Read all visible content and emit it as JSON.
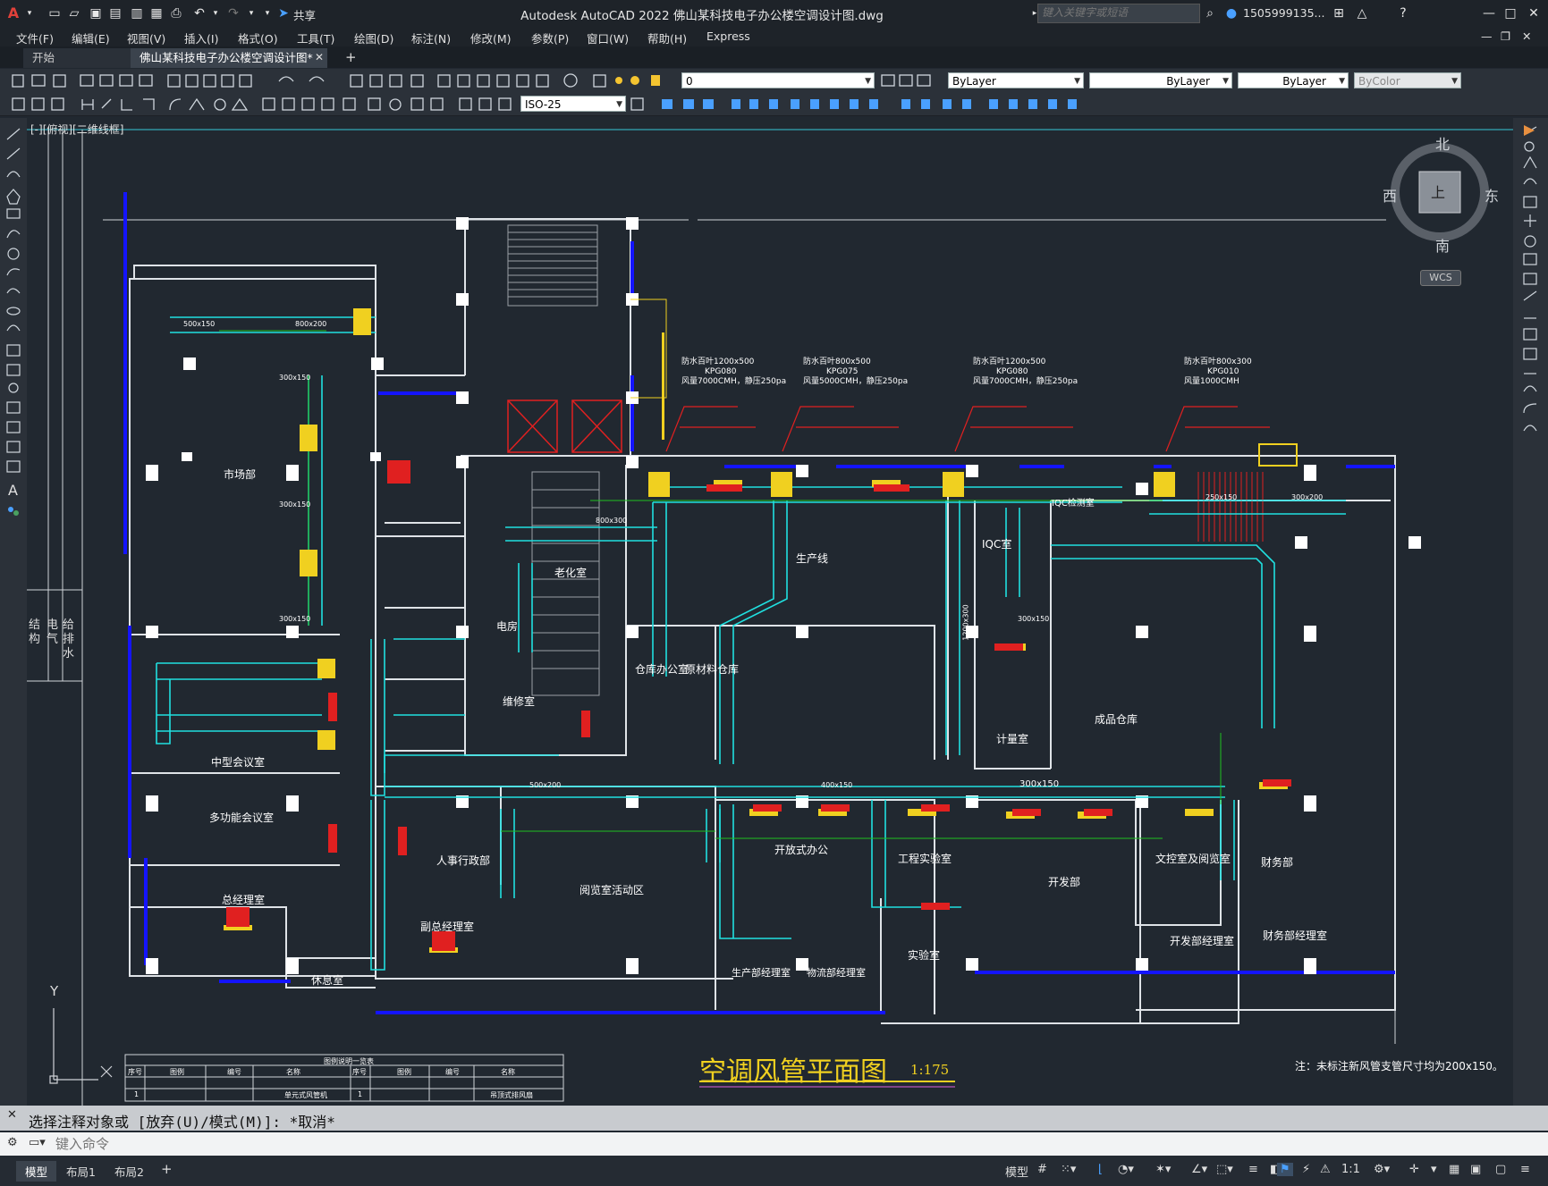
{
  "app": {
    "title": "Autodesk AutoCAD 2022    佛山某科技电子办公楼空调设计图.dwg",
    "share_label": "共享",
    "search_placeholder": "键入关键字或短语",
    "user": "1505999135...",
    "logo": "A"
  },
  "menu": [
    "文件(F)",
    "编辑(E)",
    "视图(V)",
    "插入(I)",
    "格式(O)",
    "工具(T)",
    "绘图(D)",
    "标注(N)",
    "修改(M)",
    "参数(P)",
    "窗口(W)",
    "帮助(H)",
    "Express"
  ],
  "tabs": {
    "start": "开始",
    "active": "佛山某科技电子办公楼空调设计图*",
    "add": "+"
  },
  "toolbar": {
    "layer_value": "0",
    "color_value": "ByLayer",
    "linetype_value": "ByLayer",
    "lineweight_value": "ByLayer",
    "plotstyle_value": "ByColor",
    "dimstyle_value": "ISO-25"
  },
  "viewport": {
    "label": "[-][俯视][二维线框]"
  },
  "viewcube": {
    "north": "北",
    "south": "南",
    "east": "东",
    "west": "西",
    "top": "上",
    "wcs": "WCS"
  },
  "ucs": {
    "x": "X",
    "y": "Y"
  },
  "drawing": {
    "title": "空调风管平面图",
    "scale": "1:175",
    "note": "注：未标注新风管支管尺寸均为200x150。",
    "rooms": [
      {
        "name": "市场部"
      },
      {
        "name": "中型会议室"
      },
      {
        "name": "多功能会议室"
      },
      {
        "name": "总经理室"
      },
      {
        "name": "休息室"
      },
      {
        "name": "副总经理室"
      },
      {
        "name": "人事行政部"
      },
      {
        "name": "阅览室活动区"
      },
      {
        "name": "开放式办公"
      },
      {
        "name": "生产部经理室"
      },
      {
        "name": "物流部经理室"
      },
      {
        "name": "工程实验室"
      },
      {
        "name": "实验室"
      },
      {
        "name": "开发部"
      },
      {
        "name": "文控室及阅览室"
      },
      {
        "name": "财务部"
      },
      {
        "name": "开发部经理室"
      },
      {
        "name": "财务部经理室"
      },
      {
        "name": "老化室"
      },
      {
        "name": "电房"
      },
      {
        "name": "维修室"
      },
      {
        "name": "仓库办公室"
      },
      {
        "name": "原材料仓库"
      },
      {
        "name": "生产线"
      },
      {
        "name": "IQC室"
      },
      {
        "name": "计量室"
      },
      {
        "name": "成品仓库"
      },
      {
        "name": "IQC检测室"
      }
    ],
    "fan_labels": [
      {
        "line1": "防水百叶1200x500",
        "line2": "KPG080",
        "line3": "风量7000CMH，静压250pa"
      },
      {
        "line1": "防水百叶800x500",
        "line2": "KPG075",
        "line3": "风量5000CMH，静压250pa"
      },
      {
        "line1": "防水百叶1200x500",
        "line2": "KPG080",
        "line3": "风量7000CMH，静压250pa"
      },
      {
        "line1": "防水百叶800x300",
        "line2": "KPG010",
        "line3": "风量1000CMH"
      }
    ],
    "duct_sizes": [
      "500x150",
      "800x200",
      "300x150",
      "300x150",
      "300x150",
      "800x300",
      "500x200",
      "400x150",
      "300x150",
      "250x150",
      "300x200",
      "1200x300",
      "300x150"
    ],
    "side_labels": [
      "结构",
      "电气",
      "给排水"
    ],
    "legend": {
      "title": "图例说明一览表",
      "headers": [
        "序号",
        "图例",
        "编号",
        "名称",
        "序号",
        "图例",
        "编号",
        "名称"
      ],
      "row": [
        "1",
        "",
        "",
        "单元式风管机",
        "1",
        "",
        "",
        "吊顶式排风扇"
      ]
    }
  },
  "command": {
    "history": "选择注释对象或 [放弃(U)/模式(M)]: *取消*",
    "placeholder": "键入命令"
  },
  "layout_tabs": [
    "模型",
    "布局1",
    "布局2"
  ],
  "status": {
    "model": "模型",
    "scale": "1:1"
  }
}
